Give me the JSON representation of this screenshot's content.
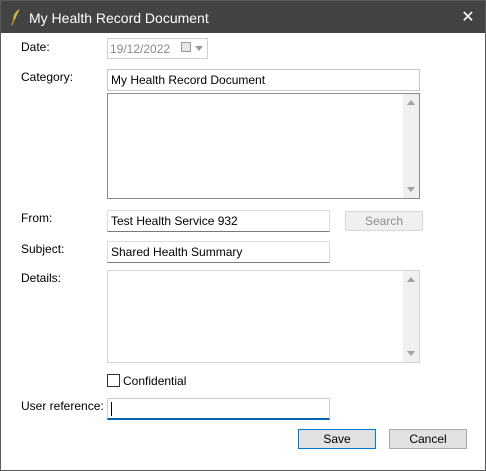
{
  "window": {
    "title": "My Health Record Document",
    "close_glyph": "✕"
  },
  "form": {
    "date_label": "Date:",
    "date_value": "19/12/2022",
    "category_label": "Category:",
    "category_value": "My Health Record Document",
    "from_label": "From:",
    "from_value": "Test Health Service 932",
    "search_label": "Search",
    "subject_label": "Subject:",
    "subject_value": "Shared Health Summary",
    "details_label": "Details:",
    "confidential_label": "Confidential",
    "confidential_checked": false,
    "user_reference_label": "User reference:",
    "user_reference_value": ""
  },
  "buttons": {
    "save": "Save",
    "cancel": "Cancel"
  },
  "icons": {
    "app": "quill-icon",
    "close": "close-icon",
    "calendar": "calendar-icon",
    "dropdown": "chevron-down-icon"
  },
  "colors": {
    "titlebar": "#434343",
    "focus": "#0063b1",
    "default_button_border": "#0078d7"
  }
}
